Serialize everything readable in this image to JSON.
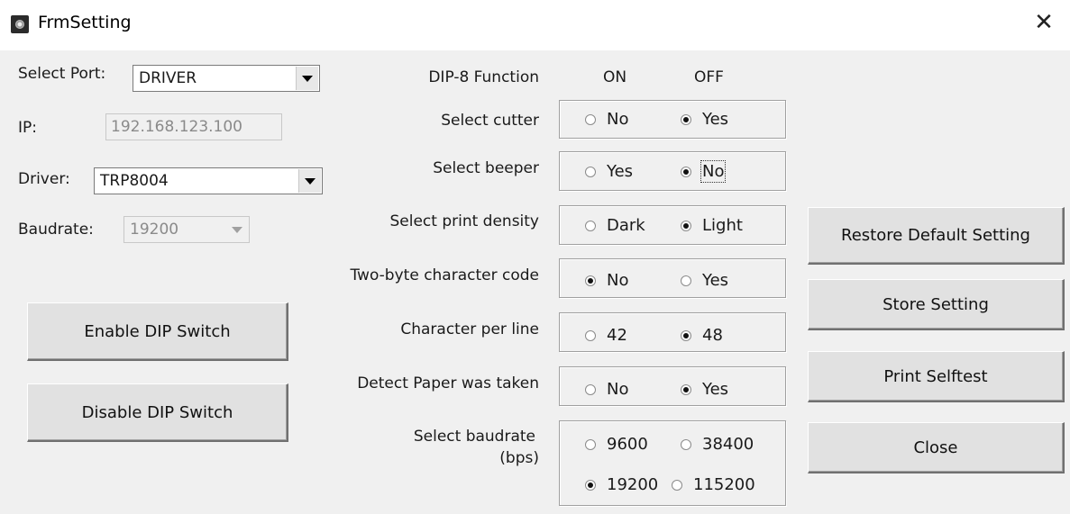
{
  "window": {
    "title": "FrmSetting",
    "close_glyph": "✕"
  },
  "left": {
    "port_label": "Select Port:",
    "port_value": "DRIVER",
    "ip_label": "IP:",
    "ip_value": "192.168.123.100",
    "driver_label": "Driver:",
    "driver_value": "TRP8004",
    "baud_label": "Baudrate:",
    "baud_value": "19200",
    "enable_dip": "Enable DIP Switch",
    "disable_dip": "Disable DIP Switch"
  },
  "dip": {
    "header": "DIP-8 Function",
    "on": "ON",
    "off": "OFF",
    "rows": [
      {
        "label": "Select cutter",
        "a": "No",
        "b": "Yes",
        "selected": "b"
      },
      {
        "label": "Select beeper",
        "a": "Yes",
        "b": "No",
        "selected": "b"
      },
      {
        "label": "Select print density",
        "a": "Dark",
        "b": "Light",
        "selected": "b"
      },
      {
        "label": "Two-byte character code",
        "a": "No",
        "b": "Yes",
        "selected": "a"
      },
      {
        "label": "Character per line",
        "a": "42",
        "b": "48",
        "selected": "b"
      },
      {
        "label": "Detect Paper was taken",
        "a": "No",
        "b": "Yes",
        "selected": "b"
      }
    ],
    "baud_label_line1": "Select baudrate",
    "baud_label_line2": "(bps)",
    "baud_options": [
      "9600",
      "38400",
      "19200",
      "115200"
    ],
    "baud_selected": "19200"
  },
  "right": {
    "restore": "Restore Default Setting",
    "store": "Store Setting",
    "selftest": "Print Selftest",
    "close": "Close"
  }
}
